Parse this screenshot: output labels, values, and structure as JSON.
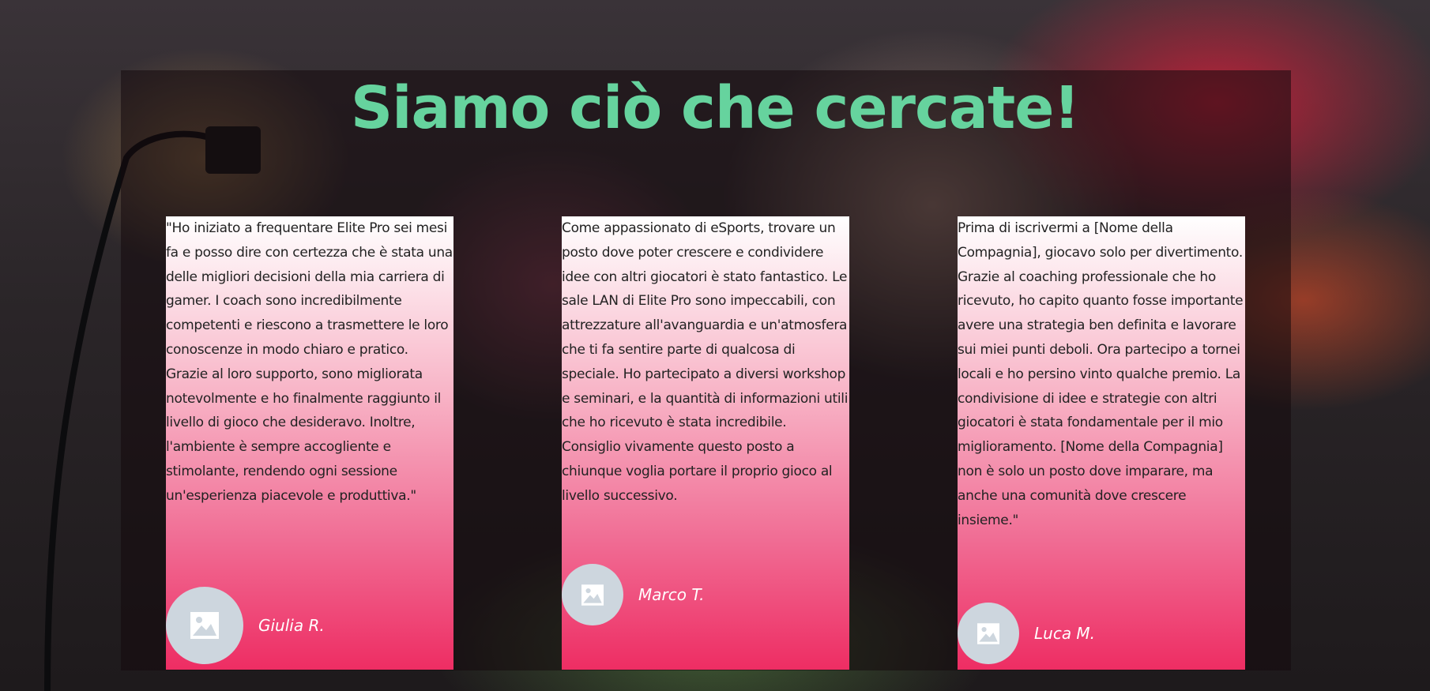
{
  "headline": "Siamo ciò che cercate!",
  "testimonials": [
    {
      "text": "\"Ho iniziato a frequentare Elite Pro sei mesi fa e posso dire con certezza che è stata una delle migliori decisioni della mia carriera di gamer. I coach sono incredibilmente competenti e riescono a trasmettere le loro conoscenze in modo chiaro e pratico. Grazie al loro supporto, sono migliorata notevolmente e ho finalmente raggiunto il livello di gioco che desideravo. Inoltre, l'ambiente è sempre accogliente e stimolante, rendendo ogni sessione un'esperienza piacevole e produttiva.\"",
      "author": "Giulia R.",
      "avatar_icon": "image-placeholder-icon"
    },
    {
      "text": "Come appassionato di eSports, trovare un posto dove poter crescere e condividere idee con altri giocatori è stato fantastico. Le sale LAN di Elite Pro sono impeccabili, con attrezzature all'avanguardia e un'atmosfera che ti fa sentire parte di qualcosa di speciale. Ho partecipato a diversi workshop e seminari, e la quantità di informazioni utili che ho ricevuto è stata incredibile. Consiglio vivamente questo posto a chiunque voglia portare il proprio gioco al livello successivo.",
      "author": "Marco T.",
      "avatar_icon": "image-placeholder-icon"
    },
    {
      "text": "Prima di iscrivermi a [Nome della Compagnia], giocavo solo per divertimento. Grazie al coaching professionale che ho ricevuto, ho capito quanto fosse importante avere una strategia ben definita e lavorare sui miei punti deboli. Ora partecipo a tornei locali e ho persino vinto qualche premio. La condivisione di idee e strategie con altri giocatori è stata fondamentale per il mio miglioramento. [Nome della Compagnia] non è solo un posto dove imparare, ma anche una comunità dove crescere insieme.\"",
      "author": "Luca M.",
      "avatar_icon": "image-placeholder-icon"
    }
  ],
  "colors": {
    "headline": "#66d39e",
    "card_top": "#ffffff",
    "card_bottom": "#ee2d63",
    "avatar_bg": "#cdd6de"
  }
}
